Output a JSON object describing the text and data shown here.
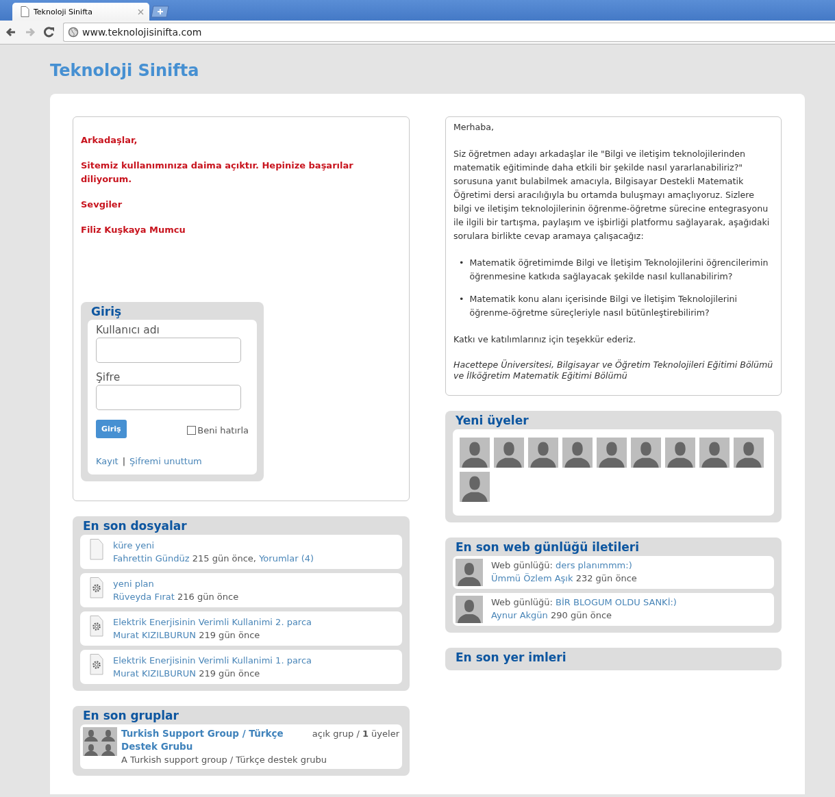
{
  "browser": {
    "tab_title": "Teknoloji Sinifta",
    "url": "www.teknolojisinifta.com"
  },
  "site_title": "Teknoloji Sinifta",
  "welcome": {
    "lines": [
      "Arkadaşlar,",
      "Sitemiz kullanımınıza daima açıktır. Hepinize başarılar diliyorum.",
      "Sevgiler",
      "Filiz Kuşkaya Mumcu"
    ]
  },
  "login": {
    "title": "Giriş",
    "username_label": "Kullanıcı adı",
    "password_label": "Şifre",
    "submit": "Giriş",
    "remember": {
      "label": "Beni hatırla",
      "checked": false
    },
    "register": "Kayıt",
    "separator": "|",
    "forgot": "Şifremi unuttum"
  },
  "info": {
    "greeting": "Merhaba,",
    "paragraph": "Siz öğretmen adayı arkadaşlar ile \"Bilgi ve iletişim teknolojilerinden matematik eğitiminde daha etkili bir şekilde nasıl yararlanabiliriz?\" sorusuna yanıt bulabilmek amacıyla, Bilgisayar Destekli Matematik Öğretimi dersi aracılığıyla bu ortamda buluşmayı amaçlıyoruz. Sizlere bilgi ve iletişim teknolojilerinin öğrenme-öğretme sürecine entegrasyonu ile ilgili bir tartışma, paylaşım ve işbirliği platformu sağlayarak, aşağıdaki sorulara birlikte cevap aramaya çalışacağız:",
    "questions": [
      {
        "marker": "•",
        "text": "Matematik öğretimimde Bilgi ve İletişim Teknolojilerini öğrencilerimin öğrenmesine katkıda sağlayacak şekilde nasıl kullanabilirim?"
      },
      {
        "marker": "•",
        "text": "Matematik konu alanı içerisinde Bilgi ve İletişim Teknolojilerini öğrenme-öğretme süreçleriyle nasıl bütünleştirebilirim?"
      }
    ],
    "closing": "Katkı ve katılımlarınız için teşekkür ederiz.",
    "signature": "Hacettepe Üniversitesi, Bilgisayar ve Öğretim Teknolojileri Eğitimi Bölümü ve İlköğretim Matematik Eğitimi Bölümü"
  },
  "files": {
    "title": "En son dosyalar",
    "items": [
      {
        "kind": "blank",
        "title": "küre yeni",
        "author": "Fahrettin Gündüz",
        "time": "215 gün önce,",
        "comments": "Yorumlar (4)"
      },
      {
        "kind": "gear",
        "title": "yeni plan",
        "author": "Rüveyda Fırat",
        "time": "216 gün önce"
      },
      {
        "kind": "gear",
        "title": "Elektrik Enerjisinin Verimli Kullanimi 2. parca",
        "author": "Murat KIZILBURUN",
        "time": "219 gün önce"
      },
      {
        "kind": "gear",
        "title": "Elektrik Enerjisinin Verimli Kullanimi 1. parca",
        "author": "Murat KIZILBURUN",
        "time": "219 gün önce"
      }
    ]
  },
  "groups": {
    "title": "En son gruplar",
    "items": [
      {
        "name": "Turkish Support Group / Türkçe Destek Grubu",
        "meta": "açık grup / **1** üyeler",
        "description": "A Turkish support group / Türkçe destek grubu"
      }
    ]
  },
  "new_members": {
    "title": "Yeni üyeler",
    "avatars": [
      {
        "kind": "default"
      },
      {
        "kind": "default"
      },
      {
        "kind": "default"
      },
      {
        "kind": "default"
      },
      {
        "kind": "default"
      },
      {
        "kind": "default"
      },
      {
        "kind": "default"
      },
      {
        "kind": "default"
      },
      {
        "kind": "default"
      },
      {
        "kind": "default"
      }
    ]
  },
  "blogs": {
    "title": "En son web günlüğü iletileri",
    "items": [
      {
        "label": "Web günlüğü:",
        "title": "ders planımmm:)",
        "author": "Ümmü Özlem Aşık",
        "time": "232 gün önce"
      },
      {
        "label": "Web günlüğü:",
        "title": "BİR BLOGUM OLDU SANKİ:)",
        "author": "Aynur Akgün",
        "time": "290 gün önce"
      }
    ]
  },
  "bookmarks": {
    "title": "En son yer imleri"
  }
}
